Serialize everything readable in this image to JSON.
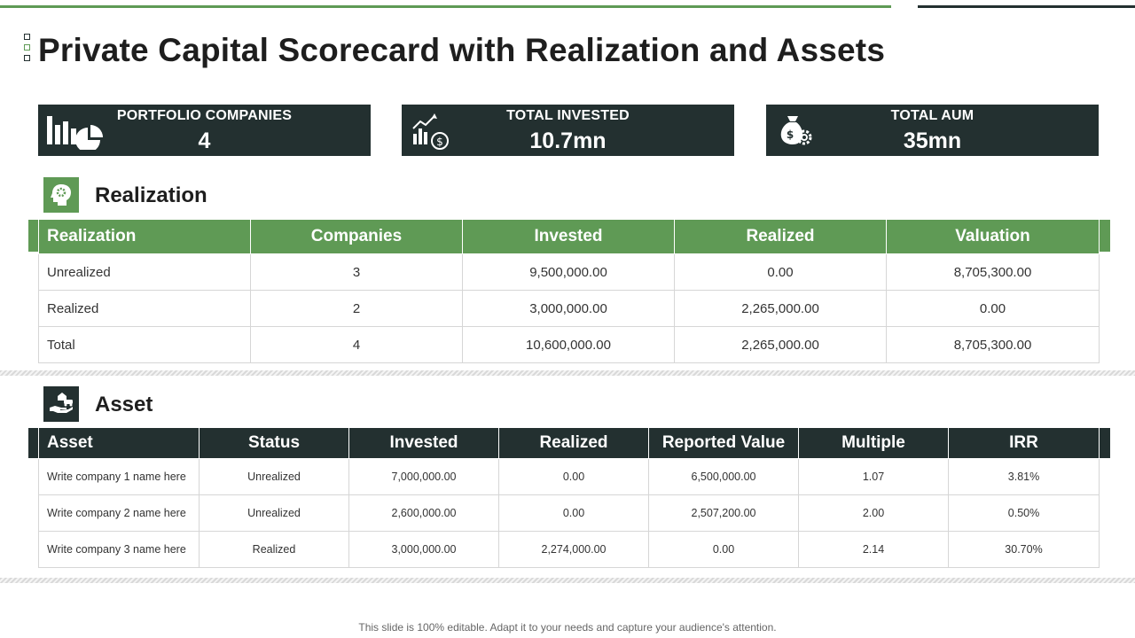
{
  "colors": {
    "accent": "#5f9a55",
    "dark": "#233030"
  },
  "title": "Private Capital Scorecard with Realization and Assets",
  "kpis": [
    {
      "label": "PORTFOLIO COMPANIES",
      "value": "4",
      "icon": "bar-pie-chart-icon"
    },
    {
      "label": "TOTAL INVESTED",
      "value": "10.7mn",
      "icon": "growth-chart-dollar-icon"
    },
    {
      "label": "TOTAL AUM",
      "value": "35mn",
      "icon": "money-bag-gear-icon"
    }
  ],
  "realization": {
    "title": "Realization",
    "icon": "head-gear-icon",
    "headers": [
      "Realization",
      "Companies",
      "Invested",
      "Realized",
      "Valuation"
    ],
    "rows": [
      [
        "Unrealized",
        "3",
        "9,500,000.00",
        "0.00",
        "8,705,300.00"
      ],
      [
        "Realized",
        "2",
        "3,000,000.00",
        "2,265,000.00",
        "0.00"
      ],
      [
        "Total",
        "4",
        "10,600,000.00",
        "2,265,000.00",
        "8,705,300.00"
      ]
    ]
  },
  "asset": {
    "title": "Asset",
    "icon": "hand-car-home-icon",
    "headers": [
      "Asset",
      "Status",
      "Invested",
      "Realized",
      "Reported Value",
      "Multiple",
      "IRR"
    ],
    "rows": [
      [
        "Write company 1 name here",
        "Unrealized",
        "7,000,000.00",
        "0.00",
        "6,500,000.00",
        "1.07",
        "3.81%"
      ],
      [
        "Write company 2 name here",
        "Unrealized",
        "2,600,000.00",
        "0.00",
        "2,507,200.00",
        "2.00",
        "0.50%"
      ],
      [
        "Write company 3 name here",
        "Realized",
        "3,000,000.00",
        "2,274,000.00",
        "0.00",
        "2.14",
        "30.70%"
      ]
    ]
  },
  "footer": "This slide is 100% editable. Adapt it to your needs and capture your audience's attention."
}
